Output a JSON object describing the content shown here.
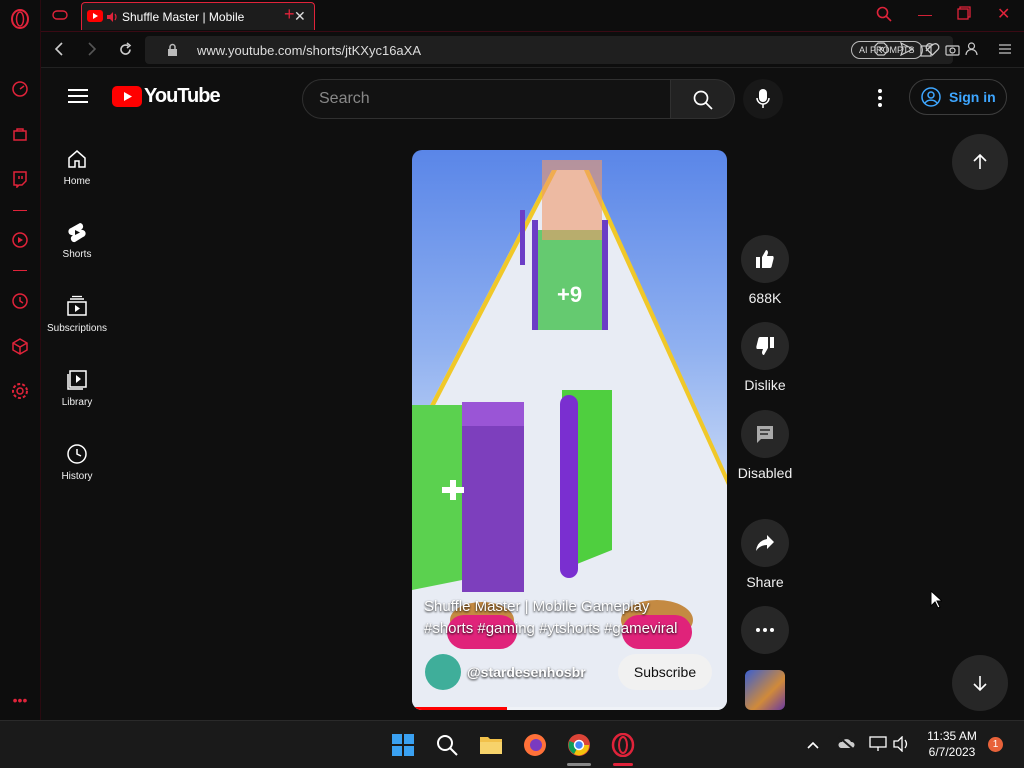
{
  "browser": {
    "tab_title": "Shuffle Master | Mobile",
    "url": "www.youtube.com/shorts/jtKXyc16aXA",
    "ai_prompts_label": "AI PROMPTS",
    "accent": "#e0233a"
  },
  "youtube": {
    "logo_text": "YouTube",
    "search_placeholder": "Search",
    "signin_label": "Sign in",
    "nav": [
      {
        "label": "Home",
        "icon": "home-icon"
      },
      {
        "label": "Shorts",
        "icon": "shorts-icon"
      },
      {
        "label": "Subscriptions",
        "icon": "subscriptions-icon"
      },
      {
        "label": "Library",
        "icon": "library-icon"
      },
      {
        "label": "History",
        "icon": "history-icon"
      }
    ],
    "video": {
      "title_line1": "Shuffle Master | Mobile Gameplay",
      "title_line2": "#shorts #gaming #ytshorts #gameviral",
      "channel": "@stardesenhosbr",
      "subscribe_label": "Subscribe",
      "overlay_plus9": "+9",
      "progress_percent": 30
    },
    "actions": {
      "like_count": "688K",
      "dislike_label": "Dislike",
      "comments_label": "Disabled",
      "share_label": "Share"
    }
  },
  "taskbar": {
    "time": "11:35 AM",
    "date": "6/7/2023",
    "notification_count": "1"
  }
}
